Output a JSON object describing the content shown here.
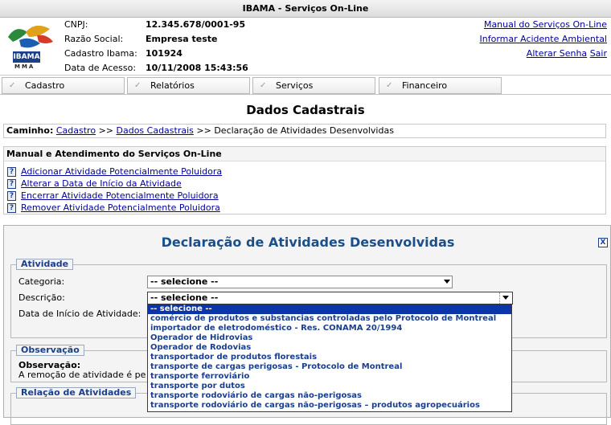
{
  "window": {
    "title": "IBAMA - Serviços On-Line"
  },
  "logo": {
    "text": "IBAMA",
    "subtext": "MMA"
  },
  "company": [
    {
      "label": "CNPJ:",
      "value": "12.345.678/0001-95"
    },
    {
      "label": "Razão Social:",
      "value": "Empresa teste"
    },
    {
      "label": "Cadastro Ibama:",
      "value": "101924"
    },
    {
      "label": "Data de Acesso:",
      "value": "10/11/2008 15:43:56"
    }
  ],
  "toplinks": {
    "manual": "Manual do Serviços On-Line",
    "acidente": "Informar Acidente Ambiental",
    "senha": "Alterar Senha",
    "sair": "Sair"
  },
  "menu": [
    "Cadastro",
    "Relatórios",
    "Serviços",
    "Financeiro"
  ],
  "page_title": "Dados Cadastrais",
  "breadcrumb": {
    "label": "Caminho:",
    "link1": "Cadastro",
    "sep": ">>",
    "link2": "Dados Cadastrais",
    "current": "Declaração de Atividades Desenvolvidas"
  },
  "manual_box": {
    "title": "Manual e Atendimento do Serviços On-Line",
    "items": [
      "Adicionar Atividade Potencialmente Poluidora",
      "Alterar a Data de Início da Atividade",
      "Encerrar Atividade Potencialmente Poluidora",
      "Remover Atividade Potencialmente Poluidora"
    ]
  },
  "declaration": {
    "title": "Declaração de Atividades Desenvolvidas",
    "close_icon": "X",
    "atividade": {
      "legend": "Atividade",
      "categoria_label": "Categoria:",
      "categoria_value": "-- selecione --",
      "descricao_label": "Descrição:",
      "descricao_value": "-- selecione --",
      "data_label": "Data de Início de Atividade:"
    },
    "observacao": {
      "legend": "Observação",
      "title": "Observação:",
      "text": "A remoção de atividade é pe"
    },
    "relacao": {
      "legend": "Relação de Atividades"
    }
  },
  "dropdown_options": [
    "-- selecione --",
    "comércio de produtos e substancias controladas pelo Protocolo de Montreal",
    "importador de eletrodoméstico - Res. CONAMA 20/1994",
    "Operador de Hidrovias",
    "Operador de Rodovias",
    "transportador de produtos florestais",
    "transporte de cargas perigosas - Protocolo de Montreal",
    "transporte ferroviário",
    "transporte por dutos",
    "transporte rodoviário de cargas não-perigosas",
    "transporte rodoviário de cargas não-perigosas – produtos agropecuários"
  ],
  "colors": {
    "accent": "#1b3f8a",
    "selection": "#0b35a8",
    "link": "#00009c"
  },
  "icons": [
    "help-icon",
    "close-icon",
    "checkmark-icon",
    "chevron-down-icon"
  ]
}
